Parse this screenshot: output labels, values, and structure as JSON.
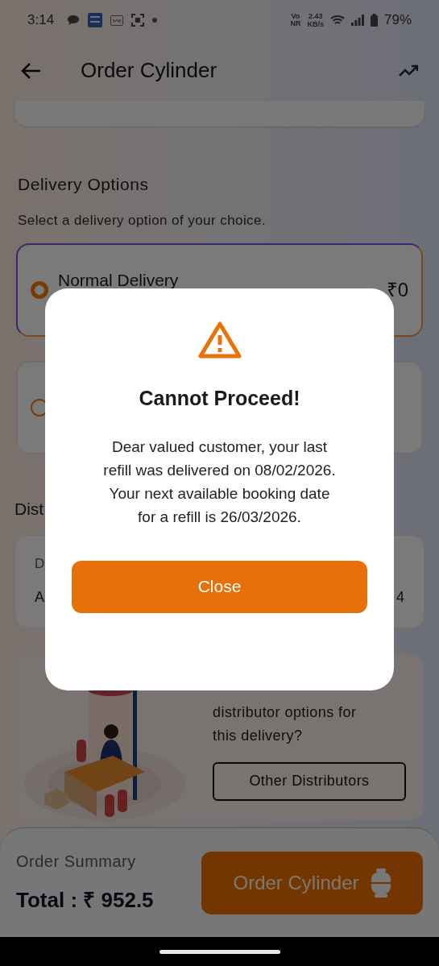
{
  "status_bar": {
    "time": "3:14",
    "network_label": [
      "Vo",
      "NR"
    ],
    "speed": [
      "2.43",
      "KB/s"
    ],
    "battery": "79%"
  },
  "app_bar": {
    "title": "Order Cylinder"
  },
  "delivery": {
    "heading": "Delivery Options",
    "subtitle": "Select a delivery option of your choice.",
    "options": [
      {
        "name": "Normal Delivery",
        "price": "₹0",
        "selected": true
      },
      {
        "selected": false
      }
    ]
  },
  "distributor": {
    "heading": "Dist",
    "label": "D",
    "name": "A",
    "value": "4"
  },
  "promo": {
    "text": "distributor options for this delivery?",
    "button": "Other Distributors"
  },
  "summary": {
    "label": "Order Summary",
    "total": "Total : ₹ 952.5",
    "button": "Order Cylinder"
  },
  "dialog": {
    "title": "Cannot Proceed!",
    "message": "Dear valued customer, your last refill was delivered on 08/02/2026. Your next available booking date for a refill is 26/03/2026.",
    "button": "Close"
  }
}
